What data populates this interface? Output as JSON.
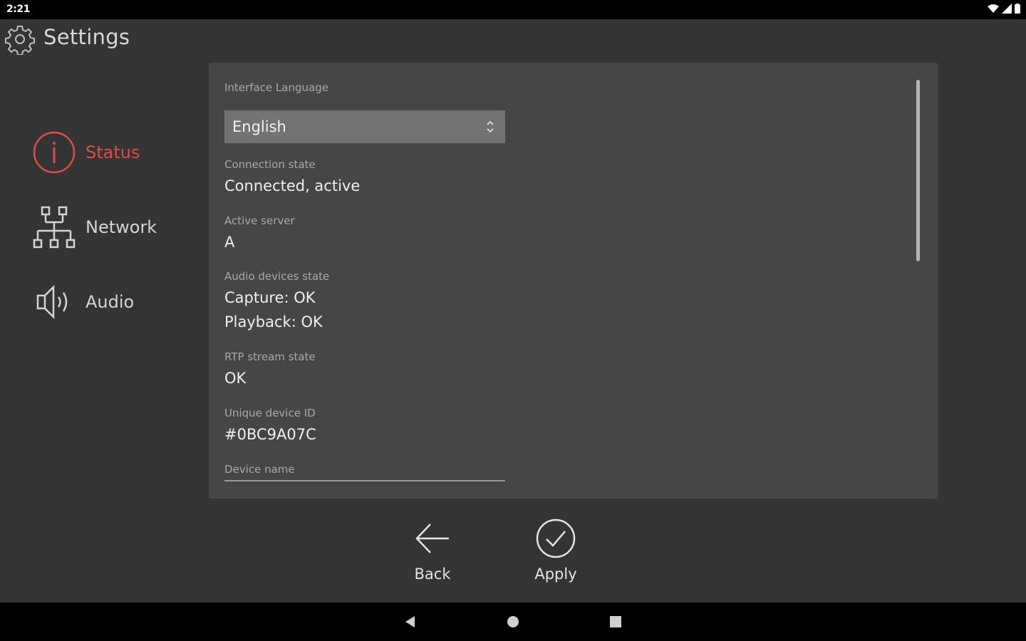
{
  "status_bar": {
    "time": "2:21"
  },
  "header": {
    "title": "Settings"
  },
  "sidebar": {
    "items": [
      {
        "label": "Status",
        "active": true
      },
      {
        "label": "Network",
        "active": false
      },
      {
        "label": "Audio",
        "active": false
      }
    ]
  },
  "panel": {
    "language": {
      "label": "Interface Language",
      "value": "English"
    },
    "connection": {
      "label": "Connection state",
      "value": "Connected, active"
    },
    "server": {
      "label": "Active server",
      "value": "A"
    },
    "audio": {
      "label": "Audio devices state",
      "capture": "Capture: OK",
      "playback": "Playback: OK"
    },
    "rtp": {
      "label": "RTP stream state",
      "value": "OK"
    },
    "device_id": {
      "label": "Unique device ID",
      "value": "#0BC9A07C"
    },
    "device_name": {
      "label": "Device name"
    }
  },
  "actions": {
    "back": "Back",
    "apply": "Apply"
  },
  "colors": {
    "accent": "#e24a4a",
    "background": "#343434",
    "panel": "#464646",
    "select": "#737373"
  }
}
